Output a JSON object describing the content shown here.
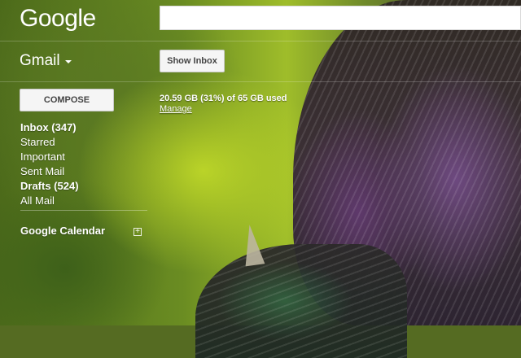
{
  "header": {
    "logo_text": "Google",
    "search": {
      "value": "",
      "placeholder": ""
    }
  },
  "toolbar": {
    "app_menu_label": "Gmail",
    "show_inbox_label": "Show Inbox"
  },
  "sidebar": {
    "compose_label": "COMPOSE",
    "items": [
      {
        "label": "Inbox (347)",
        "bold": true
      },
      {
        "label": "Starred",
        "bold": false
      },
      {
        "label": "Important",
        "bold": false
      },
      {
        "label": "Sent Mail",
        "bold": false
      },
      {
        "label": "Drafts (524)",
        "bold": true
      },
      {
        "label": "All Mail",
        "bold": false
      }
    ],
    "calendar_label": "Google Calendar",
    "calendar_add_glyph": "+"
  },
  "main": {
    "storage_text": "20.59 GB (31%) of 65 GB used",
    "manage_link": "Manage"
  },
  "colors": {
    "text": "#ffffff",
    "button_bg": "#f5f5f5",
    "button_text": "#444444"
  },
  "icons": {
    "dropdown": "chevron-down-icon",
    "add": "plus-icon"
  }
}
